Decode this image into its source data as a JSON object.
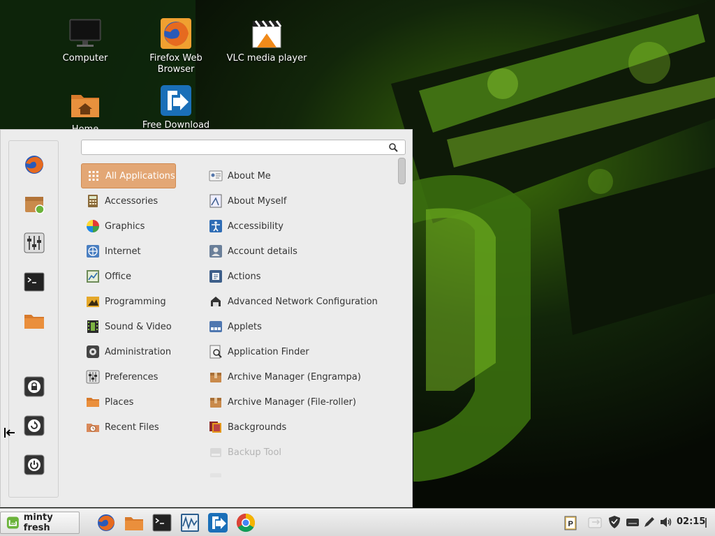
{
  "desktop": {
    "icons": [
      {
        "name": "computer",
        "label": "Computer"
      },
      {
        "name": "firefox",
        "label": "Firefox Web Browser"
      },
      {
        "name": "vlc",
        "label": "VLC media player"
      },
      {
        "name": "home",
        "label": "Home"
      },
      {
        "name": "free-download",
        "label": "Free Download"
      }
    ]
  },
  "menu": {
    "search": {
      "value": "",
      "placeholder": ""
    },
    "favorites": [
      "firefox-icon",
      "software-manager-icon",
      "settings-icon",
      "terminal-icon",
      "folder-icon"
    ],
    "session": [
      "lock-screen-icon",
      "logout-icon",
      "power-icon"
    ],
    "categories": [
      {
        "label": "All Applications",
        "icon": "grid-icon",
        "active": true
      },
      {
        "label": "Accessories",
        "icon": "calculator-icon"
      },
      {
        "label": "Graphics",
        "icon": "color-wheel-icon"
      },
      {
        "label": "Internet",
        "icon": "globe-icon"
      },
      {
        "label": "Office",
        "icon": "chart-icon"
      },
      {
        "label": "Programming",
        "icon": "programming-icon"
      },
      {
        "label": "Sound & Video",
        "icon": "film-icon"
      },
      {
        "label": "Administration",
        "icon": "gear-icon"
      },
      {
        "label": "Preferences",
        "icon": "sliders-icon"
      },
      {
        "label": "Places",
        "icon": "folder-icon"
      },
      {
        "label": "Recent Files",
        "icon": "recent-files-icon"
      }
    ],
    "applications": [
      {
        "label": "About Me",
        "icon": "id-card-icon"
      },
      {
        "label": "About Myself",
        "icon": "document-icon"
      },
      {
        "label": "Accessibility",
        "icon": "accessibility-icon"
      },
      {
        "label": "Account details",
        "icon": "user-icon"
      },
      {
        "label": "Actions",
        "icon": "actions-icon"
      },
      {
        "label": "Advanced Network Configuration",
        "icon": "network-icon"
      },
      {
        "label": "Applets",
        "icon": "applets-icon"
      },
      {
        "label": "Application Finder",
        "icon": "search-doc-icon"
      },
      {
        "label": "Archive Manager (Engrampa)",
        "icon": "archive-icon"
      },
      {
        "label": "Archive Manager (File-roller)",
        "icon": "archive-icon"
      },
      {
        "label": "Backgrounds",
        "icon": "backgrounds-icon"
      },
      {
        "label": "Backup Tool",
        "icon": "backup-icon",
        "dim": true
      }
    ]
  },
  "panel": {
    "menu_label": "minty fresh",
    "launchers": [
      "firefox-icon",
      "files-icon",
      "terminal-icon",
      "system-monitor-icon",
      "free-download-icon",
      "chrome-icon"
    ],
    "tray": [
      "clipboard-icon",
      "update-icon",
      "shield-icon",
      "keyboard-icon",
      "pen-icon",
      "volume-icon"
    ],
    "clock": "02:15"
  },
  "colors": {
    "accent": "#e3a775",
    "mint": "#6bb33b"
  }
}
